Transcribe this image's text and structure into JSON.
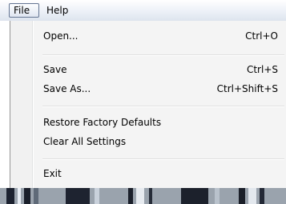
{
  "menubar": {
    "file_label": "File",
    "help_label": "Help"
  },
  "file_menu": {
    "open_label": "Open...",
    "open_shortcut": "Ctrl+O",
    "save_label": "Save",
    "save_shortcut": "Ctrl+S",
    "saveas_label": "Save As...",
    "saveas_shortcut": "Ctrl+Shift+S",
    "restore_label": "Restore Factory Defaults",
    "clear_label": "Clear All Settings",
    "exit_label": "Exit"
  },
  "colors": {
    "menu_background": "#f4f4f4",
    "active_menu_border": "#647592",
    "separator": "#e0e0e0"
  }
}
